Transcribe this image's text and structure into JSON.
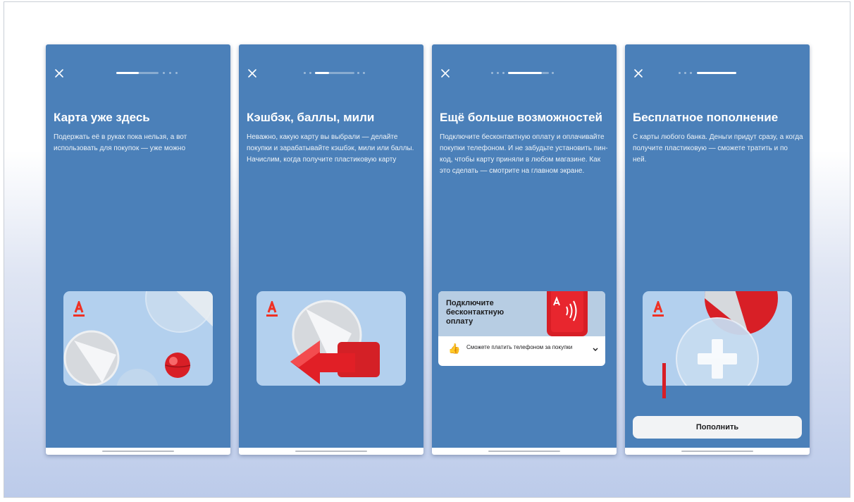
{
  "slides": [
    {
      "title": "Карта уже здесь",
      "description": "Подержать её в руках пока нельзя, а вот использовать для покупок — уже можно"
    },
    {
      "title": "Кэшбэк, баллы, мили",
      "description": "Неважно, какую карту вы выбрали — делайте покупки и зарабатывайте кэшбэк, мили или баллы. Начислим, когда получите пластиковую карту"
    },
    {
      "title": "Ещё больше возможностей",
      "description": "Подключите бесконтактную оплату и оплачивайте покупки телефоном. И не забудьте установить пин-код, чтобы карту приняли в любом магазине. Как это сделать — смотрите на главном экране.",
      "widget": {
        "title": "Подключите бесконтактную оплату",
        "note": "Сможете платить телефоном за покупки"
      }
    },
    {
      "title": "Бесплатное пополнение",
      "description": "С карты любого банка. Деньги придут сразу, а когда получите пластиковую — сможете тратить и по ней.",
      "button_label": "Пополнить"
    }
  ],
  "colors": {
    "screen_bg": "#4b80b9",
    "brand_red": "#ef3124",
    "card_bg": "#b3d0ee"
  },
  "icons": {
    "close": "close-icon",
    "logo": "alfa-logo-icon",
    "thumb": "thumbs-up-icon",
    "chevron": "chevron-down-icon",
    "nfc": "contactless-icon",
    "plus": "plus-icon"
  }
}
